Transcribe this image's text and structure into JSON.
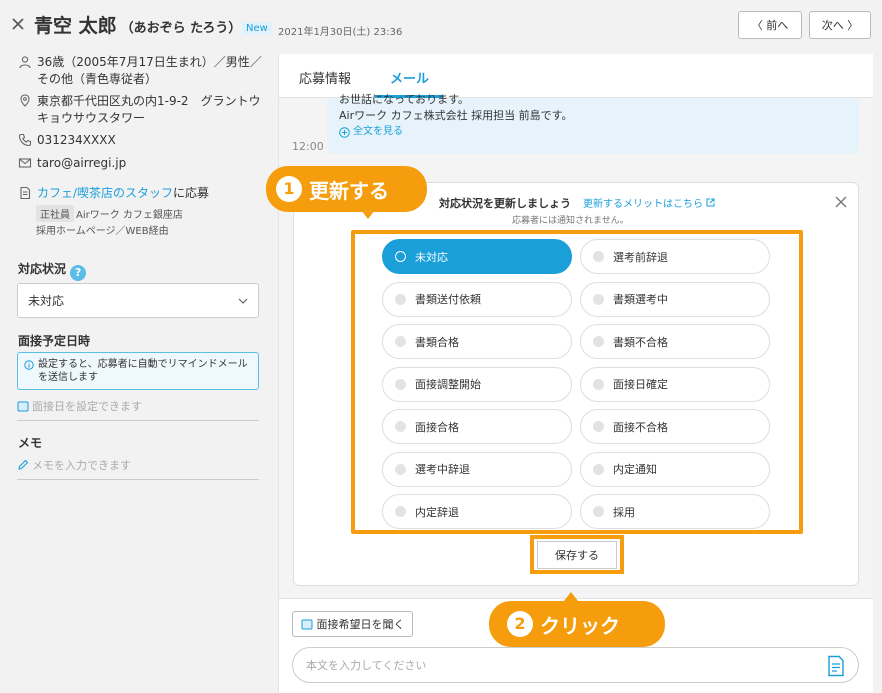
{
  "header": {
    "name": "青空 太郎",
    "kana": "（あおぞら たろう）",
    "badge": "New",
    "date": "2021年1月30日(土) 23:36",
    "prev_label": "〈 前へ",
    "next_label": "次へ 〉"
  },
  "applicant": {
    "age_gender": "36歳（2005年7月17日生まれ）／男性／その他（青色専従者）",
    "address": "東京都千代田区丸の内1-9-2　グラントウキョウサウスタワー",
    "phone": "031234XXXX",
    "email": "taro@airregi.jp",
    "job_title": "カフェ/喫茶店のスタッフ",
    "job_suffix": "に応募",
    "employment_type": "正社員",
    "store": "Airワーク カフェ銀座店",
    "source": "採用ホームページ／WEB経由"
  },
  "status_section": {
    "label": "対応状況",
    "help": "?",
    "selected": "未対応"
  },
  "interview_section": {
    "label": "面接予定日時",
    "notice": "設定すると、応募者に自動でリマインドメールを送信します",
    "placeholder": "面接日を設定できます"
  },
  "memo_section": {
    "label": "メモ",
    "placeholder": "メモを入力できます"
  },
  "tabs": [
    {
      "label": "応募情報",
      "active": false
    },
    {
      "label": "メール",
      "active": true
    }
  ],
  "message": {
    "line1": "お世話になっております。",
    "line2": "Airワーク カフェ株式会社 採用担当 前島です。",
    "expand": "全文を見る",
    "time": "12:00"
  },
  "status_card": {
    "title": "対応状況を更新しましょう",
    "link": "更新するメリットはこちら",
    "subtitle": "応募者には通知されません。",
    "options": [
      {
        "label": "未対応",
        "selected": true
      },
      {
        "label": "選考前辞退",
        "selected": false
      },
      {
        "label": "書類送付依頼",
        "selected": false
      },
      {
        "label": "書類選考中",
        "selected": false
      },
      {
        "label": "書類合格",
        "selected": false
      },
      {
        "label": "書類不合格",
        "selected": false
      },
      {
        "label": "面接調整開始",
        "selected": false
      },
      {
        "label": "面接日確定",
        "selected": false
      },
      {
        "label": "面接合格",
        "selected": false
      },
      {
        "label": "面接不合格",
        "selected": false
      },
      {
        "label": "選考中辞退",
        "selected": false
      },
      {
        "label": "内定通知",
        "selected": false
      },
      {
        "label": "内定辞退",
        "selected": false
      },
      {
        "label": "採用",
        "selected": false
      }
    ],
    "save_label": "保存する"
  },
  "compose": {
    "ask_label": "面接希望日を聞く",
    "placeholder": "本文を入力してください"
  },
  "callouts": {
    "step1_num": "1",
    "step1_label": "更新する",
    "step2_num": "2",
    "step2_label": "クリック"
  },
  "colors": {
    "accent": "#1a9fd9",
    "callout": "#f59d0c"
  }
}
